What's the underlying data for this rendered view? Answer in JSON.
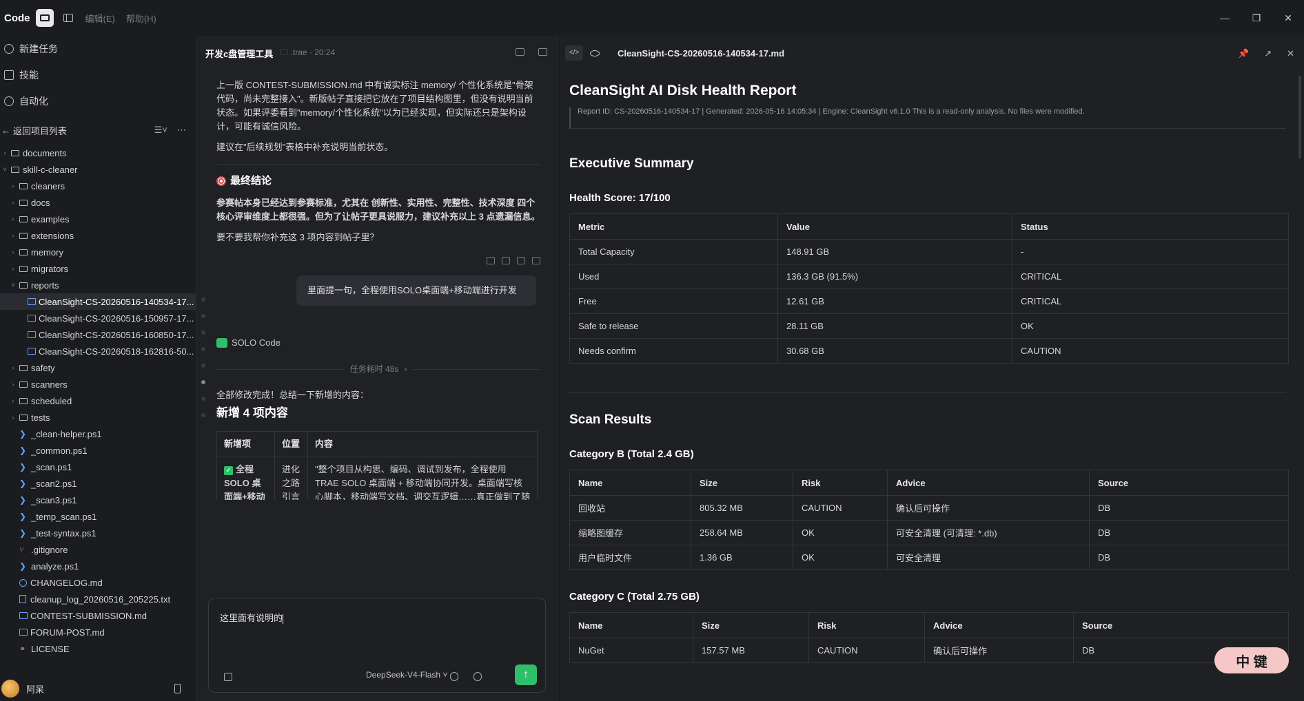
{
  "titlebar": {
    "brand": "Code",
    "menu": [
      "编辑(E)",
      "帮助(H)"
    ]
  },
  "sidebar": {
    "nav": [
      {
        "label": "新建任务",
        "icon": "new-task-icon"
      },
      {
        "label": "技能",
        "icon": "book-icon"
      },
      {
        "label": "自动化",
        "icon": "clock-icon"
      }
    ],
    "back_label": "返回项目列表",
    "tree": [
      {
        "name": "documents",
        "type": "folder",
        "depth": 0,
        "open": false
      },
      {
        "name": "skill-c-cleaner",
        "type": "folder",
        "depth": 0,
        "open": true
      },
      {
        "name": "cleaners",
        "type": "folder",
        "depth": 1,
        "open": false
      },
      {
        "name": "docs",
        "type": "folder",
        "depth": 1,
        "open": false
      },
      {
        "name": "examples",
        "type": "folder",
        "depth": 1,
        "open": false
      },
      {
        "name": "extensions",
        "type": "folder",
        "depth": 1,
        "open": false
      },
      {
        "name": "memory",
        "type": "folder",
        "depth": 1,
        "open": false
      },
      {
        "name": "migrators",
        "type": "folder",
        "depth": 1,
        "open": false
      },
      {
        "name": "reports",
        "type": "folder",
        "depth": 1,
        "open": true
      },
      {
        "name": "CleanSight-CS-20260516-140534-17...",
        "type": "md",
        "depth": 2,
        "selected": true
      },
      {
        "name": "CleanSight-CS-20260516-150957-17...",
        "type": "md",
        "depth": 2
      },
      {
        "name": "CleanSight-CS-20260516-160850-17...",
        "type": "md",
        "depth": 2
      },
      {
        "name": "CleanSight-CS-20260518-162816-50...",
        "type": "md",
        "depth": 2
      },
      {
        "name": "safety",
        "type": "folder",
        "depth": 1,
        "open": false
      },
      {
        "name": "scanners",
        "type": "folder",
        "depth": 1,
        "open": false
      },
      {
        "name": "scheduled",
        "type": "folder",
        "depth": 1,
        "open": false
      },
      {
        "name": "tests",
        "type": "folder",
        "depth": 1,
        "open": false
      },
      {
        "name": "_clean-helper.ps1",
        "type": "ps",
        "depth": 1
      },
      {
        "name": "_common.ps1",
        "type": "ps",
        "depth": 1
      },
      {
        "name": "_scan.ps1",
        "type": "ps",
        "depth": 1
      },
      {
        "name": "_scan2.ps1",
        "type": "ps",
        "depth": 1
      },
      {
        "name": "_scan3.ps1",
        "type": "ps",
        "depth": 1
      },
      {
        "name": "_temp_scan.ps1",
        "type": "ps",
        "depth": 1
      },
      {
        "name": "_test-syntax.ps1",
        "type": "ps",
        "depth": 1
      },
      {
        "name": ".gitignore",
        "type": "git",
        "depth": 1
      },
      {
        "name": "analyze.ps1",
        "type": "ps",
        "depth": 1
      },
      {
        "name": "CHANGELOG.md",
        "type": "chg",
        "depth": 1
      },
      {
        "name": "cleanup_log_20260516_205225.txt",
        "type": "txt",
        "depth": 1
      },
      {
        "name": "CONTEST-SUBMISSION.md",
        "type": "md",
        "depth": 1
      },
      {
        "name": "FORUM-POST.md",
        "type": "md",
        "depth": 1
      },
      {
        "name": "LICENSE",
        "type": "lic",
        "depth": 1
      }
    ],
    "user": "阿呆"
  },
  "chat": {
    "title": "开发c盘管理工具",
    "meta": ".trae · 20:24",
    "para1": "上一版 CONTEST-SUBMISSION.md 中有诚实标注 memory/ 个性化系统是\"骨架代码，尚未完整接入\"。新版帖子直接把它放在了项目结构图里，但没有说明当前状态。如果评委看到\"memory/个性化系统\"以为已经实现，但实际还只是架构设计，可能有诚信风险。",
    "para2": "建议在\"后续规划\"表格中补充说明当前状态。",
    "final_heading": "最终结论",
    "final_text": "参赛帖本身已经达到参赛标准，尤其在 创新性、实用性、完整性、技术深度 四个核心评审维度上都很强。但为了让帖子更具说服力，建议补充以上 3 点遗漏信息。",
    "ask": "要不要我帮你补充这 3 项内容到帖子里？",
    "user_msg": "里面提一句，全程使用SOLO桌面端+移动端进行开发",
    "agent": "SOLO Code",
    "duration": "任务耗时 48s",
    "done": "全部修改完成！总结一下新增的内容：",
    "new_heading": "新增 4 项内容",
    "table_headers": [
      "新增项",
      "位置",
      "内容"
    ],
    "table_row": {
      "item": "全程 SOLO 桌面端+移动端开发",
      "pos": "进化之路引言",
      "content": "\"整个项目从构思、编码、调试到发布，全程使用 TRAE SOLO 桌面端 + 移动端协同开发。桌面端写核心脚本，移动端写文档、调交互逻辑……真正做到了随时随地用 AI 开发 AI\""
    },
    "input_value": "这里面有说明的",
    "model": "DeepSeek-V4-Flash"
  },
  "report": {
    "filename": "CleanSight-CS-20260516-140534-17.md",
    "title": "CleanSight AI Disk Health Report",
    "subtitle": "Report ID: CS-20260516-140534-17 | Generated: 2026-05-16 14:05:34 | Engine: CleanSight v6.1.0 This is a read-only analysis. No files were modified.",
    "summary_heading": "Executive Summary",
    "health_label": "Health Score: ",
    "health_value": "17/100",
    "metrics_headers": [
      "Metric",
      "Value",
      "Status"
    ],
    "metrics": [
      [
        "Total Capacity",
        "148.91 GB",
        "-"
      ],
      [
        "Used",
        "136.3 GB (91.5%)",
        "CRITICAL"
      ],
      [
        "Free",
        "12.61 GB",
        "CRITICAL"
      ],
      [
        "Safe to release",
        "28.11 GB",
        "OK"
      ],
      [
        "Needs confirm",
        "30.68 GB",
        "CAUTION"
      ]
    ],
    "scan_heading": "Scan Results",
    "catB_heading": "Category B (Total 2.4 GB)",
    "cat_headers": [
      "Name",
      "Size",
      "Risk",
      "Advice",
      "Source"
    ],
    "catB": [
      [
        "回收站",
        "805.32 MB",
        "CAUTION",
        "确认后可操作",
        "DB"
      ],
      [
        "缩略图缓存",
        "258.64 MB",
        "OK",
        "可安全清理 (可清理: *.db)",
        "DB"
      ],
      [
        "用户临时文件",
        "1.36 GB",
        "OK",
        "可安全清理",
        "DB"
      ]
    ],
    "catC_heading": "Category C (Total 2.75 GB)",
    "catC": [
      [
        "NuGet",
        "157.57 MB",
        "CAUTION",
        "确认后可操作",
        "DB"
      ]
    ],
    "ime_badge": "中 键"
  }
}
